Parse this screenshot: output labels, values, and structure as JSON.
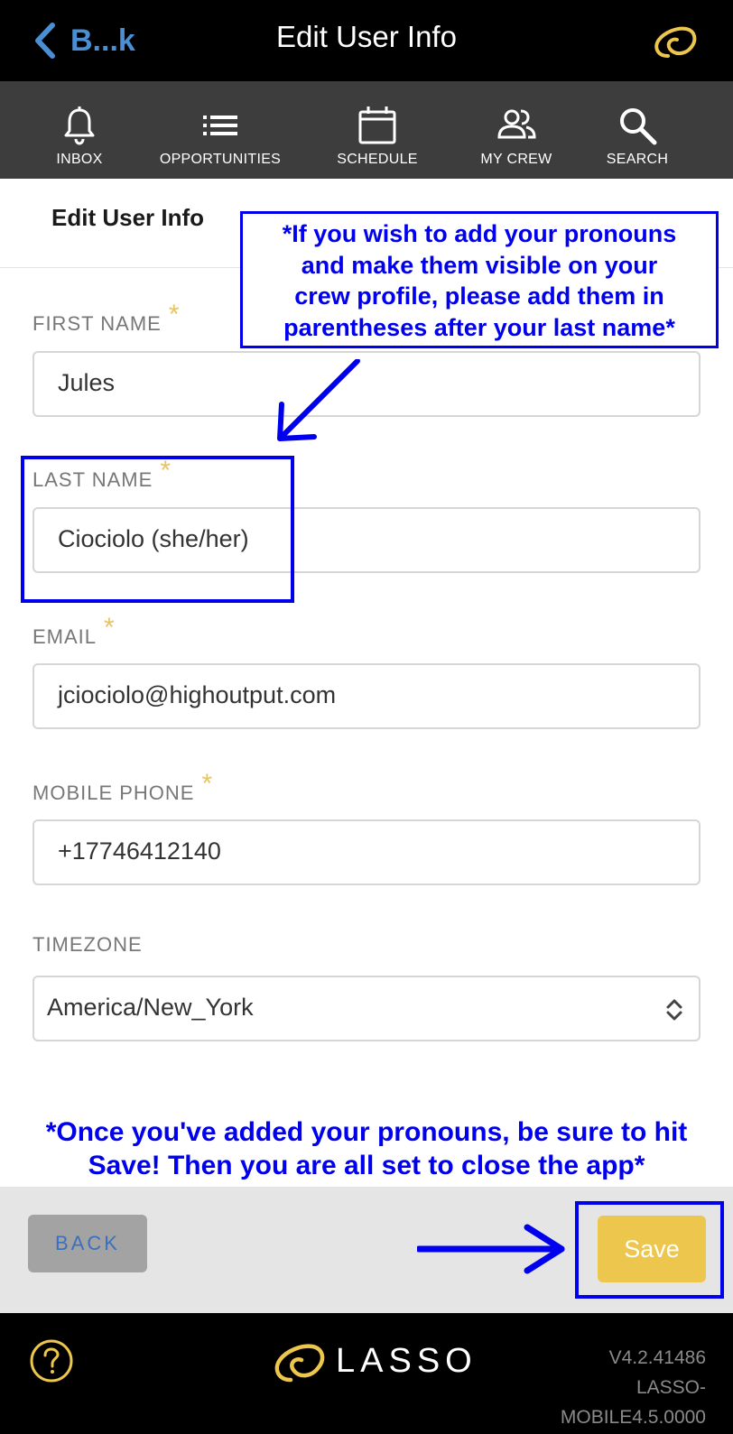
{
  "topbar": {
    "back_label": "B...k",
    "title": "Edit User Info",
    "logo_icon": "lasso-logo-icon"
  },
  "nav": {
    "items": [
      {
        "label": "INBOX",
        "icon": "bell-icon"
      },
      {
        "label": "OPPORTUNITIES",
        "icon": "list-icon"
      },
      {
        "label": "SCHEDULE",
        "icon": "calendar-icon"
      },
      {
        "label": "MY CREW",
        "icon": "people-icon"
      },
      {
        "label": "SEARCH",
        "icon": "search-icon"
      }
    ]
  },
  "page": {
    "title": "Edit User Info"
  },
  "form": {
    "required_marker": "*",
    "first_name": {
      "label": "FIRST NAME",
      "value": "Jules"
    },
    "last_name": {
      "label": "LAST NAME",
      "value": "Ciociolo (she/her)"
    },
    "email": {
      "label": "EMAIL",
      "value": "jciociolo@highoutput.com"
    },
    "mobile_phone": {
      "label": "MOBILE PHONE",
      "value": "+17746412140"
    },
    "timezone": {
      "label": "TIMEZONE",
      "value": "America/New_York"
    }
  },
  "annotations": {
    "pronoun_note": [
      "*If you wish to add your pronouns",
      "and make them visible on your",
      "crew profile, please add them in",
      "parentheses after your last name*"
    ],
    "save_note": [
      "*Once you've added your pronouns, be sure to hit",
      "Save! Then you are all set to close the app*"
    ],
    "color": "#0000ee"
  },
  "actions": {
    "back_label": "BACK",
    "save_label": "Save"
  },
  "footer": {
    "logo_text": "LASSO",
    "version_lines": [
      "V4.2.41486",
      "LASSO-",
      "MOBILE4.5.0000"
    ],
    "help_icon": "question-mark-icon"
  },
  "colors": {
    "accent_gold": "#ecc64d",
    "back_blue": "#4a8fd3",
    "nav_bg": "#3d3d3d"
  }
}
